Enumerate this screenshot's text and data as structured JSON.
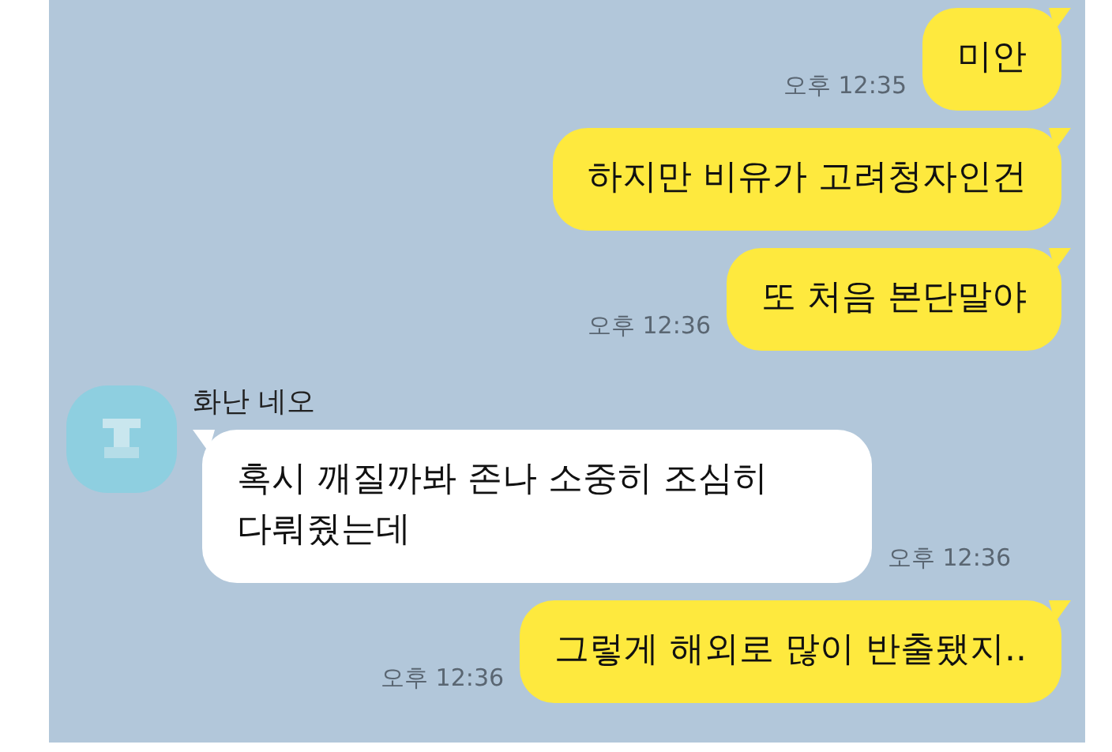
{
  "messages": [
    {
      "kind": "sent",
      "text": "미안",
      "time": "오후 12:35"
    },
    {
      "kind": "sent",
      "text": "하지만 비유가 고려청자인건"
    },
    {
      "kind": "sent",
      "text": "또 처음 본단말야",
      "time": "오후 12:36"
    },
    {
      "kind": "received",
      "sender": "화난 네오",
      "text": "혹시 깨질까봐 존나 소중히 조심히 다뤄줬는데",
      "time": "오후 12:36"
    },
    {
      "kind": "sent",
      "text": "그렇게 해외로 많이 반출됐지..",
      "time": "오후 12:36"
    }
  ]
}
